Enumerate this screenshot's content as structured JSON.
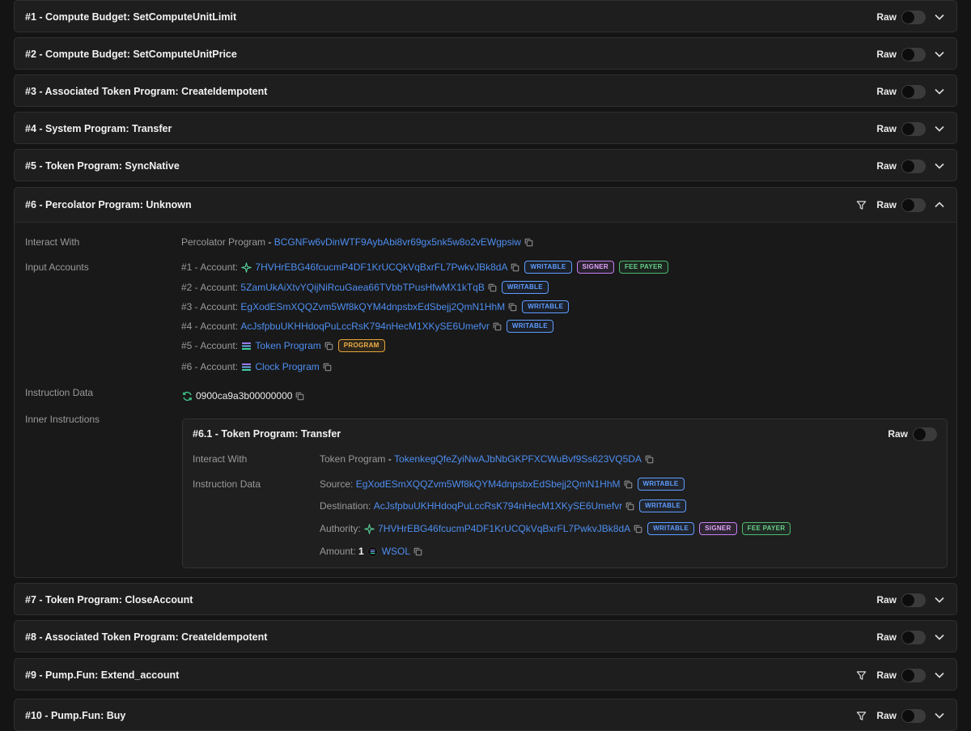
{
  "instructions": [
    {
      "title": "#1 - Compute Budget: SetComputeUnitLimit",
      "raw": "Raw"
    },
    {
      "title": "#2 - Compute Budget: SetComputeUnitPrice",
      "raw": "Raw"
    },
    {
      "title": "#3 - Associated Token Program: CreateIdempotent",
      "raw": "Raw"
    },
    {
      "title": "#4 - System Program: Transfer",
      "raw": "Raw"
    },
    {
      "title": "#5 - Token Program: SyncNative",
      "raw": "Raw"
    },
    {
      "title": "#6 - Percolator Program: Unknown",
      "raw": "Raw"
    },
    {
      "title": "#7 - Token Program: CloseAccount",
      "raw": "Raw"
    },
    {
      "title": "#8 - Associated Token Program: CreateIdempotent",
      "raw": "Raw"
    },
    {
      "title": "#9 - Pump.Fun: Extend_account",
      "raw": "Raw"
    },
    {
      "title": "#10 - Pump.Fun: Buy",
      "raw": "Raw"
    }
  ],
  "expanded": {
    "labels": {
      "interact_with": "Interact With",
      "input_accounts": "Input Accounts",
      "instruction_data": "Instruction Data",
      "inner_instructions": "Inner Instructions"
    },
    "program_name": "Percolator Program",
    "program_sep": " - ",
    "program_address": "BCGNFw6vDinWTF9AybAbi8vr69gx5nk5w8o2vEWgpsiw",
    "accounts": [
      {
        "prefix": "#1 - Account: ",
        "value": "7HVHrEBG46fcucmP4DF1KrUCQkVqBxrFL7PwkvJBk8dA",
        "icon": "sparkle-icon",
        "badges": [
          "WRITABLE",
          "SIGNER",
          "FEE PAYER"
        ]
      },
      {
        "prefix": "#2 - Account: ",
        "value": "5ZamUkAiXtvYQijNiRcuGaea66TVbbTPusHfwMX1kTqB",
        "icon": "",
        "badges": [
          "WRITABLE"
        ]
      },
      {
        "prefix": "#3 - Account: ",
        "value": "EgXodESmXQQZvm5Wf8kQYM4dnpsbxEdSbejj2QmN1HhM",
        "icon": "",
        "badges": [
          "WRITABLE"
        ]
      },
      {
        "prefix": "#4 - Account: ",
        "value": "AcJsfpbuUKHHdoqPuLccRsK794nHecM1XKySE6Umefvr",
        "icon": "",
        "badges": [
          "WRITABLE"
        ]
      },
      {
        "prefix": "#5 - Account: ",
        "value": "Token Program",
        "icon": "solana-icon",
        "badges": [
          "PROGRAM"
        ]
      },
      {
        "prefix": "#6 - Account: ",
        "value": "Clock Program",
        "icon": "solana-icon",
        "badges": []
      }
    ],
    "instruction_data": "0900ca9a3b00000000",
    "inner": {
      "title": "#6.1 - Token Program: Transfer",
      "raw": "Raw",
      "labels": {
        "interact_with": "Interact With",
        "instruction_data": "Instruction Data"
      },
      "program_name": "Token Program",
      "program_sep": " - ",
      "program_address": "TokenkegQfeZyiNwAJbNbGKPFXCWuBvf9Ss623VQ5DA",
      "source_label": "Source: ",
      "source": "EgXodESmXQQZvm5Wf8kQYM4dnpsbxEdSbejj2QmN1HhM",
      "destination_label": "Destination: ",
      "destination": "AcJsfpbuUKHHdoqPuLccRsK794nHecM1XKySE6Umefvr",
      "authority_label": "Authority: ",
      "authority": "7HVHrEBG46fcucmP4DF1KrUCQkVqBxrFL7PwkvJBk8dA",
      "amount_label": "Amount: ",
      "amount_value": "1",
      "amount_token": "WSOL",
      "badges": {
        "writable": "WRITABLE",
        "signer": "SIGNER",
        "fee_payer": "FEE PAYER"
      }
    }
  },
  "colors": {
    "link": "#4e8ef0",
    "background": "#141414",
    "card": "#1e1e1e"
  }
}
